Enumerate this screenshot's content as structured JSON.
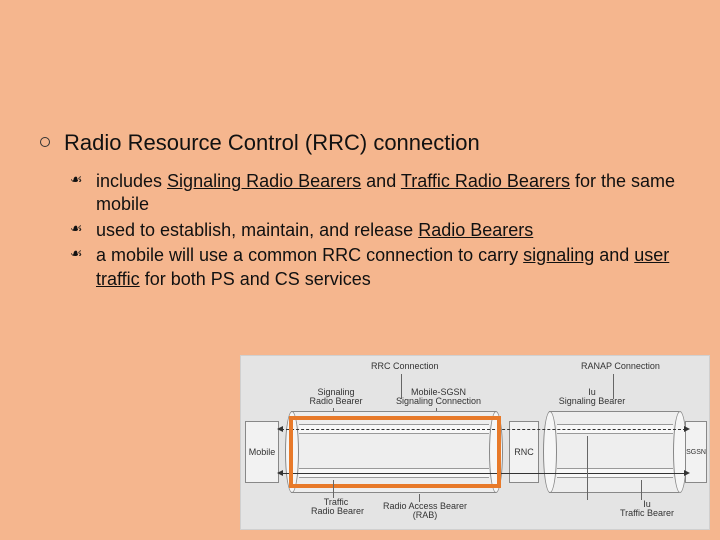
{
  "main": {
    "title": "Radio Resource Control (RRC) connection",
    "items": [
      {
        "prefix": "includes ",
        "u1": "Signaling Radio Bearers",
        "mid1": " and ",
        "u2": "Traffic Radio Bearers",
        "suffix": " for the same mobile"
      },
      {
        "prefix": "used to establish, maintain, and release ",
        "u1": "Radio Bearers",
        "mid1": "",
        "u2": "",
        "suffix": ""
      },
      {
        "prefix": "a mobile will use a common RRC connection to carry ",
        "u1": "signaling",
        "mid1": " and ",
        "u2": "user traffic",
        "suffix": " for both PS and CS services"
      }
    ]
  },
  "diagram": {
    "topLabels": {
      "rrc": "RRC Connection",
      "ranap": "RANAP Connection"
    },
    "midLabels": {
      "srb": "Signaling\nRadio Bearer",
      "msgs": "Mobile-SGSN\nSignaling Connection"
    },
    "blocks": {
      "mobile": "Mobile",
      "rnc": "RNC",
      "sgsn": "SGSN"
    },
    "bottomLabels": {
      "trb": "Traffic\nRadio Bearer",
      "rab": "Radio Access Bearer\n(RAB)",
      "iu": "Iu\nSignaling Bearer",
      "iutb": "Iu\nTraffic Bearer"
    }
  }
}
